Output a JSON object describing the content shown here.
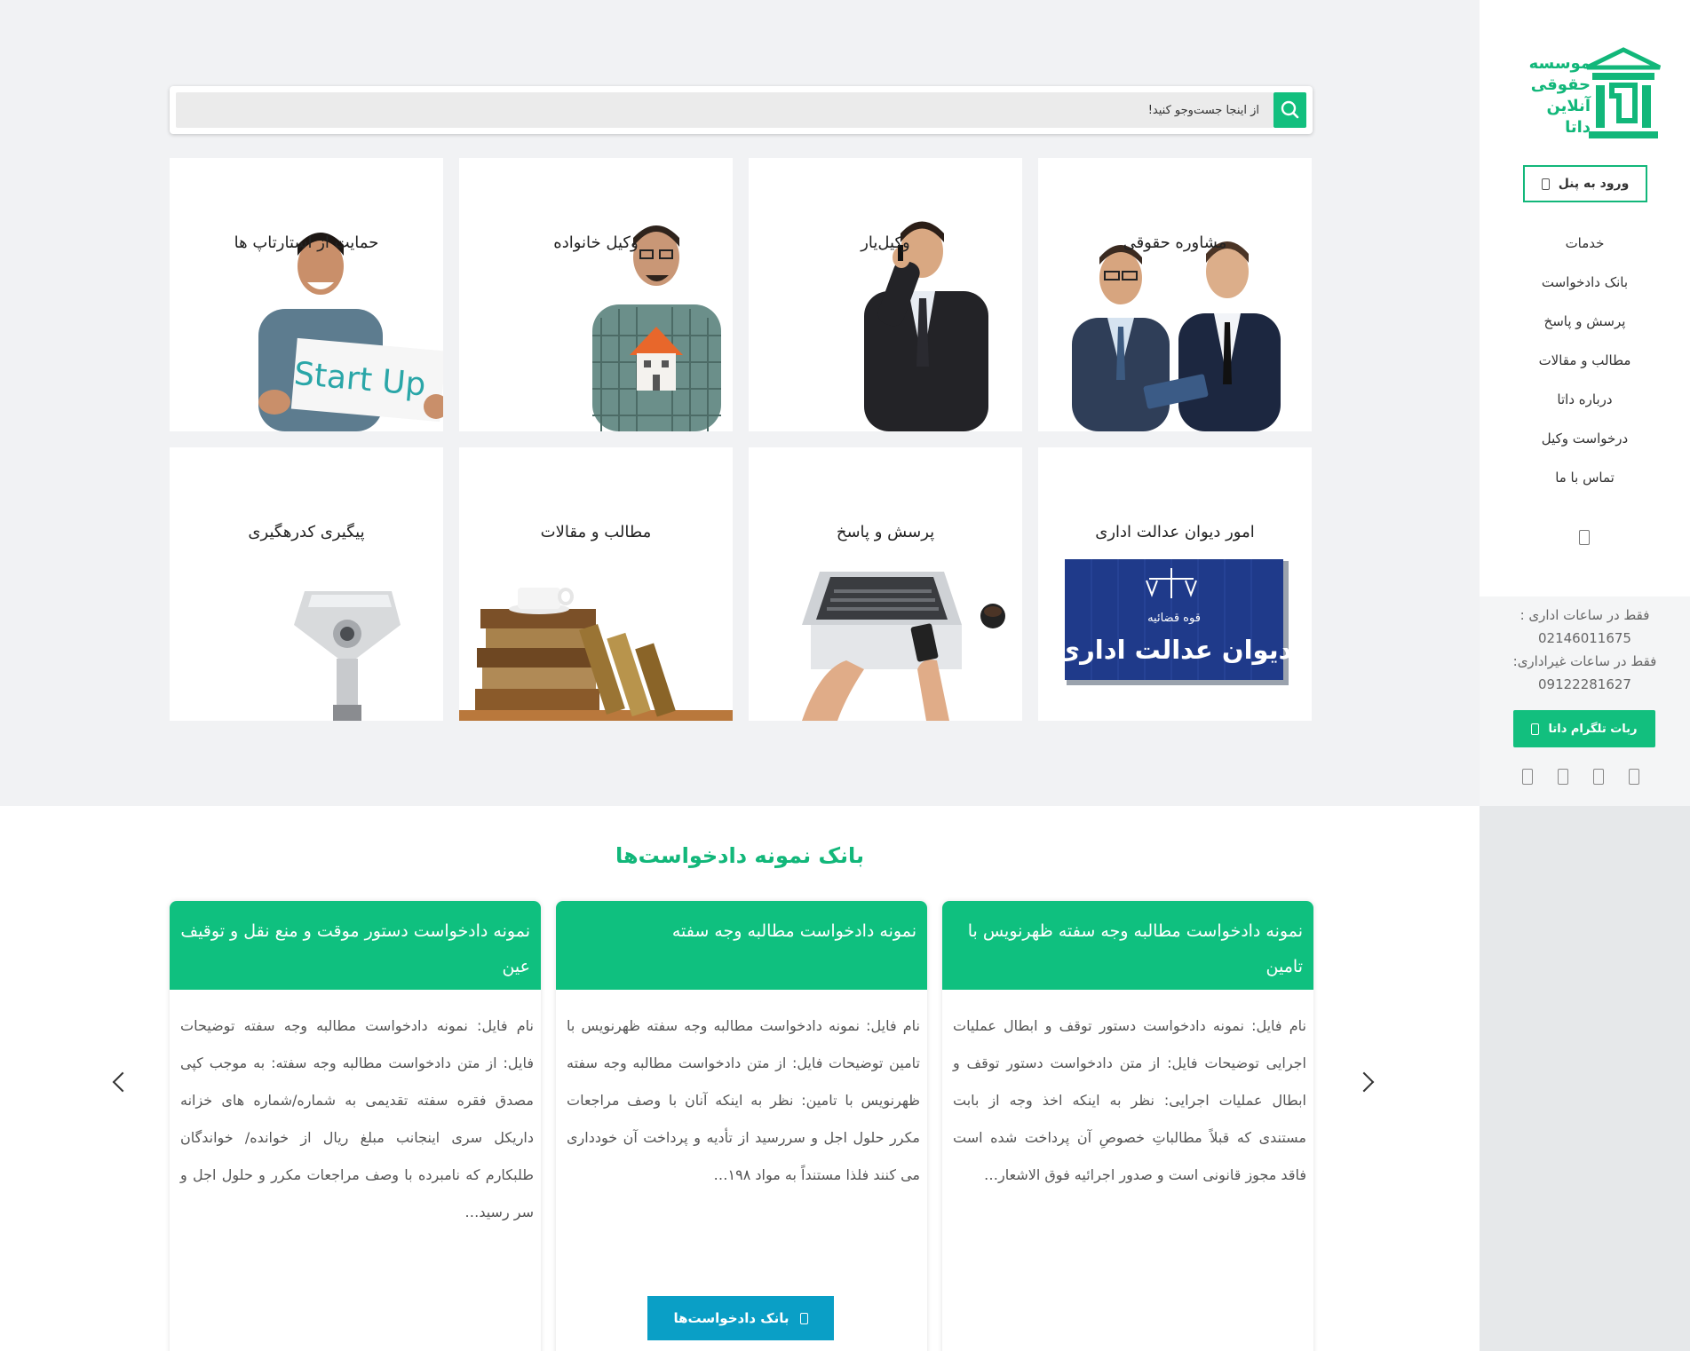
{
  "sidebar": {
    "logo_lines": [
      "موسسه",
      "حقوقی",
      "آنلاین",
      "داتا"
    ],
    "panel_button": "ورود به پنل",
    "nav": [
      "خدمات",
      "بانک دادخواست",
      "پرسش و پاسخ",
      "مطالب و مقالات",
      "درباره داتا",
      "درخواست وکیل",
      "تماس با ما"
    ],
    "office_hours_label": "فقط در ساعات اداری :",
    "office_phone": "02146011675",
    "after_hours_label": "فقط در ساعات غیراداری:",
    "after_hours_phone": "09122281627",
    "telegram_button": "ربات تلگرام داتا",
    "socials": [
      "social-icon-1",
      "social-icon-2",
      "social-icon-3",
      "social-icon-4"
    ]
  },
  "search": {
    "placeholder": "از اینجا جست‌وجو کنید!"
  },
  "services": [
    {
      "title": "مشاوره حقوقی",
      "image": "two-lawyers-reading"
    },
    {
      "title": "وکیل‌یار",
      "image": "man-on-phone"
    },
    {
      "title": "وکیل خانواده",
      "image": "man-holding-house"
    },
    {
      "title": "حمایت از استارتاپ ها",
      "image": "startup-sign"
    },
    {
      "title": "امور دیوان عدالت اداری",
      "image": "court-sign"
    },
    {
      "title": "پرسش و پاسخ",
      "image": "laptop-hands"
    },
    {
      "title": "مطالب و مقالات",
      "image": "books-cup"
    },
    {
      "title": "پیگیری کدرهگیری",
      "image": "binocular-viewer"
    }
  ],
  "court_sign_small": "قوه قضائیه",
  "court_sign_big": "دیوان عدالت اداری",
  "startup_sign": "Start Up",
  "petitions": {
    "title": "بانک نمونه دادخواست‌ها",
    "cards": [
      {
        "title": "نمونه دادخواست مطالبه وجه سفته ظهرنویس با تامین",
        "body": "نام فایل: نمونه دادخواست دستور توقف و ابطال عملیات اجرایی توضیحات فایل: از متن دادخواست دستور توقف و ابطال عملیات اجرایی: نظر به اینکه اخذ وجه از بابت مستندی که قبلاً مطالباتِ خصوصِ آن پرداخت شده است فاقد مجوز قانونی است و صدور اجرائیه فوق الاشعار…"
      },
      {
        "title": "نمونه دادخواست مطالبه وجه سفته",
        "body": "نام فایل: نمونه دادخواست مطالبه وجه سفته ظهرنویس با تامین توضیحات فایل: از متن دادخواست مطالبه وجه سفته ظهرنویس با تامین: نظر به اینکه آنان با وصف مراجعات مکرر حلول اجل و سررسید از تأدیه و پرداخت آن خودداری می کنند فلذا مستنداً به مواد ۱۹۸…"
      },
      {
        "title": "نمونه دادخواست دستور موقت و منع نقل و توقیف عین",
        "body": "نام فایل: نمونه دادخواست مطالبه وجه سفته توضیحات فایل: از متن دادخواست مطالبه وجه سفته: به موجب کپی مصدق فقره سفته تقدیمی به شماره/شماره های خزانه داریکل سری اینجانب مبلغ ریال از خوانده/ خواندگان طلبکارم که نامبرده با وصف مراجعات مکرر و حلول اجل و سر رسید…"
      }
    ],
    "button": "بانک دادخواست‌ها"
  }
}
